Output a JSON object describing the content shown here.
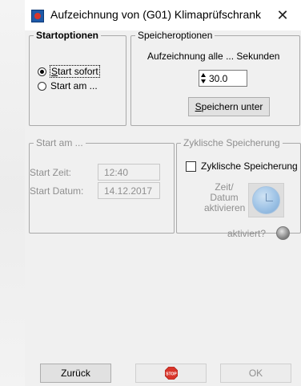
{
  "window": {
    "title": "Aufzeichnung von (G01) Klimaprüfschrank",
    "close_glyph": "✕",
    "app_icon": "recording-app-icon"
  },
  "start_options": {
    "legend": "Startoptionen",
    "options": [
      {
        "label": "Start sofort",
        "selected": true
      },
      {
        "label": "Start am ...",
        "selected": false
      }
    ]
  },
  "save_options": {
    "legend": "Speicheroptionen",
    "interval_label": "Aufzeichnung alle ... Sekunden",
    "interval_value": "30.0",
    "save_as_button": "Speichern unter"
  },
  "start_at": {
    "legend": "Start am ...",
    "time_label": "Start Zeit:",
    "time_value": "12:40",
    "date_label": "Start Datum:",
    "date_value": "14.12.2017"
  },
  "cyclic": {
    "legend": "Zyklische Speicherung",
    "checkbox_label": "Zyklische Speicherung",
    "checked": false,
    "activate_label_line1": "Zeit/",
    "activate_label_line2": "Datum",
    "activate_label_line3": "aktivieren",
    "activated_label": "aktiviert?",
    "clock_icon": "clock-icon",
    "indicator_icon": "status-led-icon"
  },
  "footer": {
    "back_button": "Zurück",
    "stop_icon_text": "STOP",
    "ok_button": "OK"
  },
  "colors": {
    "window_bg": "#f0f0f0",
    "disabled_text": "#8f8f8f",
    "stop_red": "#d9352a"
  }
}
